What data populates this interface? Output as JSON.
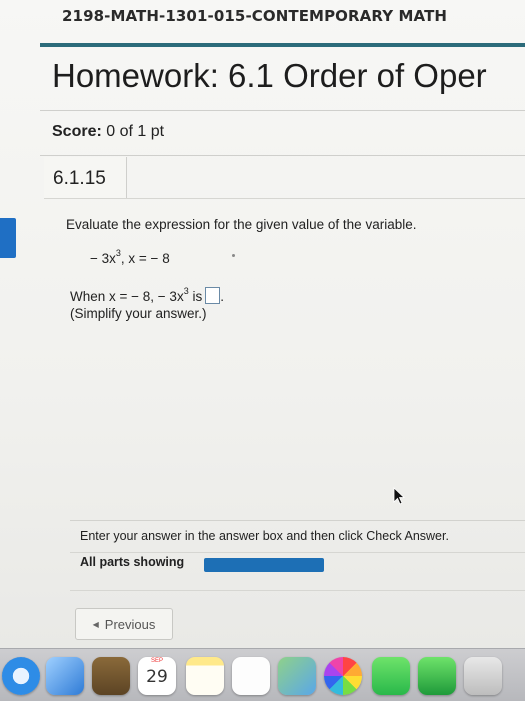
{
  "header": {
    "course_title": "2198-MATH-1301-015-CONTEMPORARY MATH",
    "homework_title": "Homework: 6.1 Order of Oper"
  },
  "score": {
    "label": "Score:",
    "value": "0 of 1 pt"
  },
  "question": {
    "number": "6.1.15",
    "instructions": "Evaluate the expression for the given value of the variable.",
    "expression_prefix": "− 3x",
    "expression_exponent": "3",
    "expression_suffix": ", x = − 8",
    "when_prefix": "When x = − 8, − 3x",
    "when_exponent": "3",
    "when_suffix": " is",
    "answer_value": "",
    "simplify_note": "(Simplify your answer.)"
  },
  "footer": {
    "enter_instruction": "Enter your answer in the answer box and then click Check Answer.",
    "parts_label": "All parts showing",
    "parts_progress": 1.0,
    "previous_label": "Previous"
  },
  "dock": {
    "calendar_month": "SEP",
    "calendar_day": "29"
  },
  "colors": {
    "accent_teal": "#2c6b7a",
    "progress_blue": "#1d6fb5",
    "tab_blue": "#1f6fc4"
  }
}
